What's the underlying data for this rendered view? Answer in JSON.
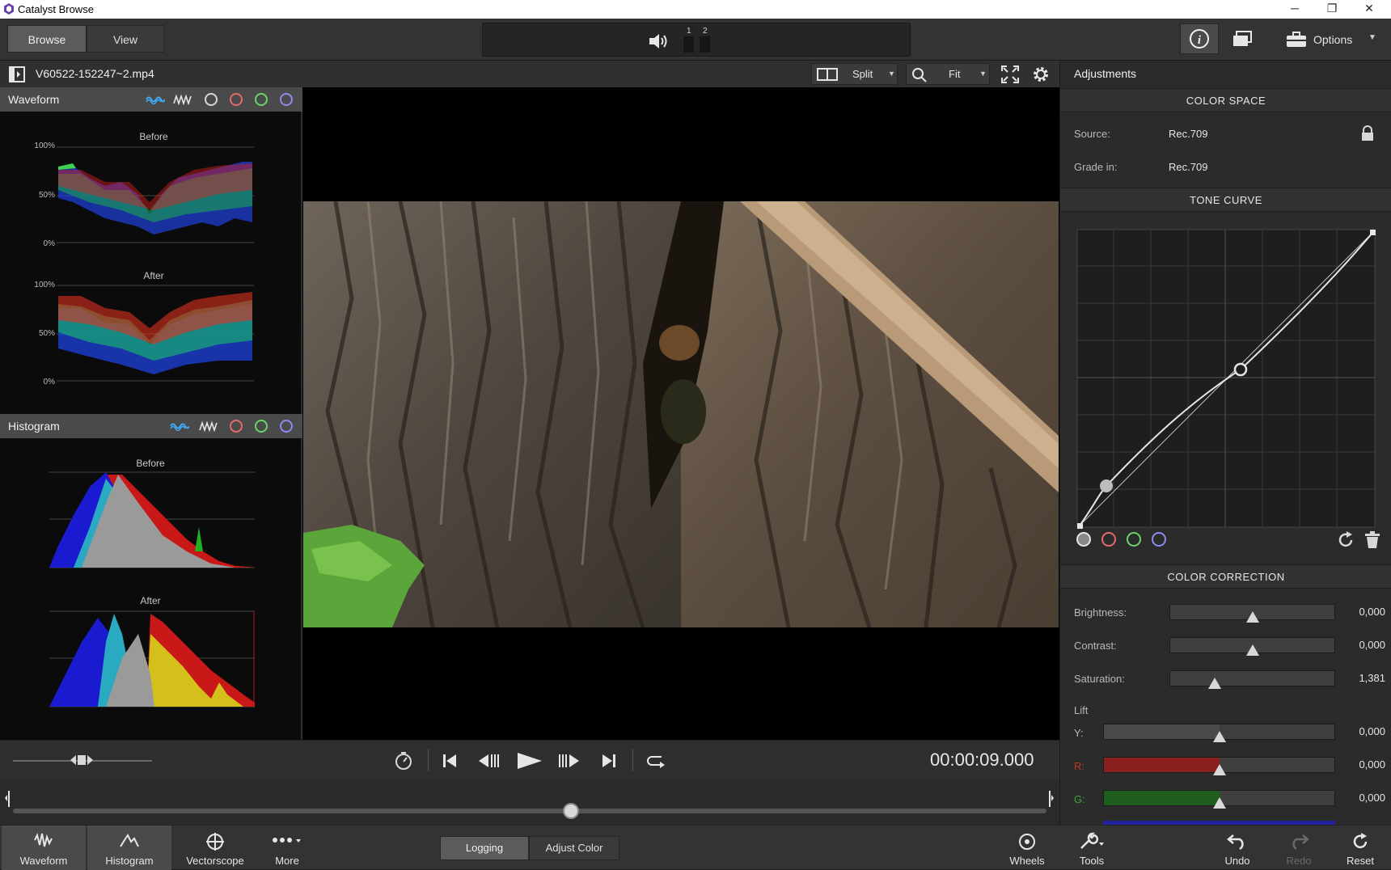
{
  "app": {
    "title": "Catalyst Browse"
  },
  "window_controls": {
    "minimize": "─",
    "restore": "❐",
    "close": "✕"
  },
  "top_tabs": [
    {
      "label": "Browse",
      "active": true
    },
    {
      "label": "View",
      "active": false
    }
  ],
  "audio_meter": {
    "channel1": "1",
    "channel2": "2"
  },
  "options_label": "Options",
  "file": {
    "name": "V60522-152247~2.mp4",
    "split_label": "Split",
    "zoom_label": "Fit"
  },
  "waveform": {
    "title": "Waveform",
    "before_label": "Before",
    "after_label": "After",
    "ticks": [
      "100%",
      "50%",
      "0%"
    ]
  },
  "histogram": {
    "title": "Histogram",
    "before_label": "Before",
    "after_label": "After"
  },
  "transport": {
    "timecode": "00:00:09.000"
  },
  "scrubber": {
    "position": 0.54
  },
  "bottom_tools": [
    {
      "label": "Waveform",
      "icon": "waveform-icon",
      "active": true
    },
    {
      "label": "Histogram",
      "icon": "histogram-icon",
      "active": true
    },
    {
      "label": "Vectorscope",
      "icon": "vectorscope-icon",
      "active": false
    },
    {
      "label": "More",
      "icon": "more-icon",
      "active": false
    }
  ],
  "mode_tabs": [
    {
      "label": "Logging",
      "active": true
    },
    {
      "label": "Adjust Color",
      "active": false
    }
  ],
  "right_tools": {
    "wheels": "Wheels",
    "tools": "Tools",
    "undo": "Undo",
    "redo": "Redo",
    "reset": "Reset"
  },
  "adjustments": {
    "title": "Adjustments",
    "color_space": {
      "header": "COLOR SPACE",
      "source_label": "Source:",
      "source_value": "Rec.709",
      "grade_label": "Grade in:",
      "grade_value": "Rec.709"
    },
    "tone_curve": {
      "header": "TONE CURVE"
    },
    "color_correction": {
      "header": "COLOR CORRECTION",
      "brightness": {
        "label": "Brightness:",
        "value": "0,000",
        "level": 0.5
      },
      "contrast": {
        "label": "Contrast:",
        "value": "0,000",
        "level": 0.5
      },
      "saturation": {
        "label": "Saturation:",
        "value": "1,381",
        "level": 0.27
      },
      "lift_label": "Lift",
      "lift": [
        {
          "label": "Y:",
          "value": "0,000",
          "level": 0.5,
          "color": "#4a4a4a",
          "label_color": "#b9b9b9"
        },
        {
          "label": "R:",
          "value": "0,000",
          "level": 0.5,
          "color": "#8a1f1f",
          "label_color": "#c0392b"
        },
        {
          "label": "G:",
          "value": "0,000",
          "level": 0.5,
          "color": "#1f5e1f",
          "label_color": "#3aa63a"
        }
      ]
    }
  }
}
